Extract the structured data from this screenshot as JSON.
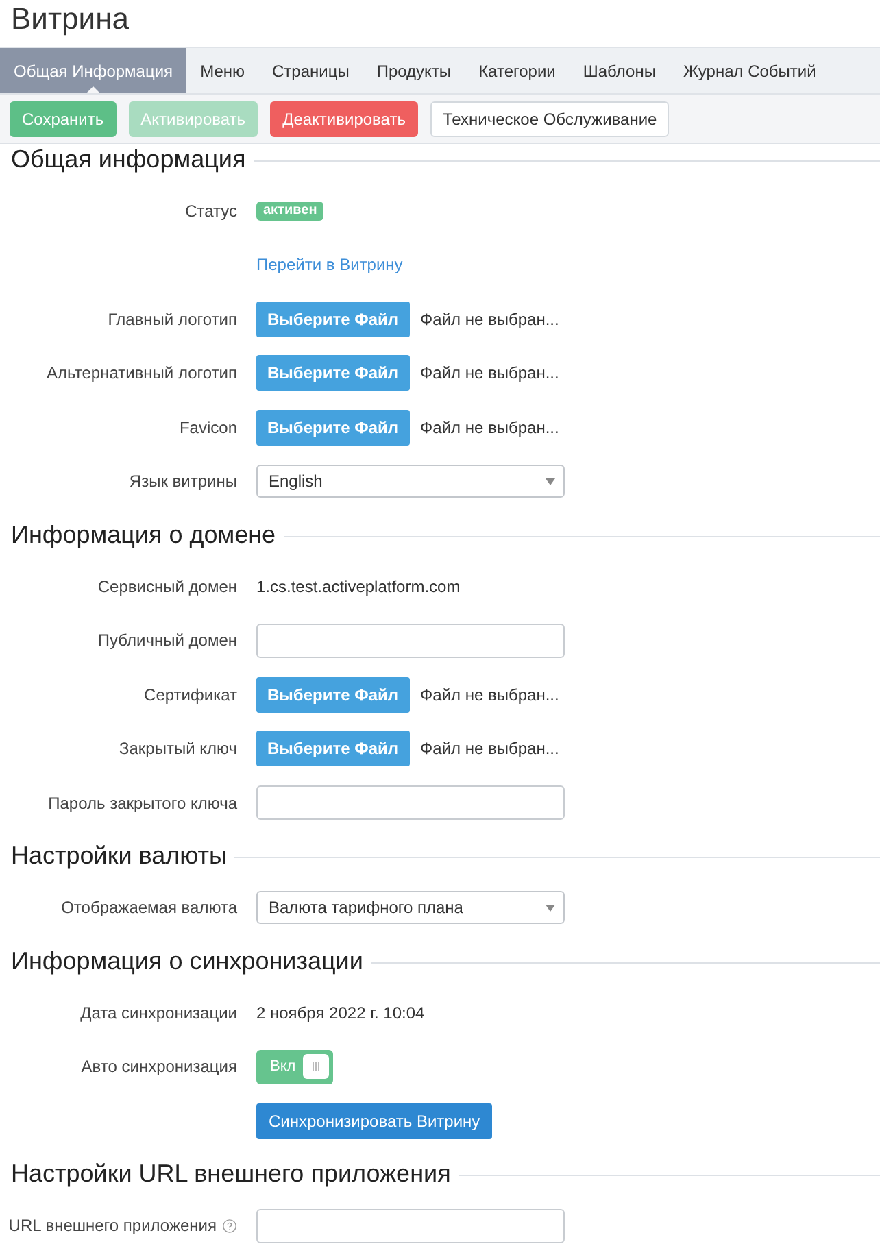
{
  "page": {
    "title": "Витрина"
  },
  "tabs": [
    {
      "label": "Общая Информация",
      "selected": true
    },
    {
      "label": "Меню",
      "selected": false
    },
    {
      "label": "Страницы",
      "selected": false
    },
    {
      "label": "Продукты",
      "selected": false
    },
    {
      "label": "Категории",
      "selected": false
    },
    {
      "label": "Шаблоны",
      "selected": false
    },
    {
      "label": "Журнал Событий",
      "selected": false
    }
  ],
  "toolbar": [
    {
      "label": "Сохранить",
      "kind": "success",
      "disabled": false
    },
    {
      "label": "Активировать",
      "kind": "success",
      "disabled": true
    },
    {
      "label": "Деактивировать",
      "kind": "danger",
      "disabled": false
    },
    {
      "label": "Техническое Обслуживание",
      "kind": "default",
      "disabled": false
    }
  ],
  "sections": [
    {
      "title": "Общая информация",
      "rows": [
        {
          "kind": "badge",
          "label": "Статус",
          "value": "активен"
        },
        {
          "kind": "link",
          "text": "Перейти в Витрину"
        },
        {
          "kind": "file",
          "label": "Главный логотип",
          "button": "Выберите Файл",
          "file": "Файл не выбран..."
        },
        {
          "kind": "file",
          "label": "Альтернативный логотип",
          "button": "Выберите Файл",
          "file": "Файл не выбран..."
        },
        {
          "kind": "file",
          "label": "Favicon",
          "button": "Выберите Файл",
          "file": "Файл не выбран..."
        },
        {
          "kind": "select",
          "label": "Язык витрины",
          "value": "English"
        }
      ]
    },
    {
      "title": "Информация о домене",
      "rows": [
        {
          "kind": "text",
          "label": "Сервисный домен",
          "value": "1.cs.test.activeplatform.com"
        },
        {
          "kind": "input",
          "label": "Публичный домен",
          "help": false
        },
        {
          "kind": "file",
          "label": "Сертификат",
          "button": "Выберите Файл",
          "file": "Файл не выбран..."
        },
        {
          "kind": "file",
          "label": "Закрытый ключ",
          "button": "Выберите Файл",
          "file": "Файл не выбран..."
        },
        {
          "kind": "input",
          "label": "Пароль закрытого ключа",
          "help": false
        }
      ]
    },
    {
      "title": "Настройки валюты",
      "rows": [
        {
          "kind": "select",
          "label": "Отображаемая валюта",
          "value": "Валюта тарифного плана"
        }
      ]
    },
    {
      "title": "Информация о синхронизации",
      "rows": [
        {
          "kind": "text",
          "label": "Дата синхронизации",
          "value": "2 ноября 2022 г. 10:04"
        },
        {
          "kind": "toggle",
          "label": "Авто синхронизация",
          "on": true,
          "text": "Вкл"
        },
        {
          "kind": "button",
          "text": "Синхронизировать Витрину"
        }
      ]
    },
    {
      "title": "Настройки URL внешнего приложения",
      "rows": [
        {
          "kind": "input",
          "label": "URL внешнего приложения",
          "help": true
        }
      ]
    }
  ]
}
